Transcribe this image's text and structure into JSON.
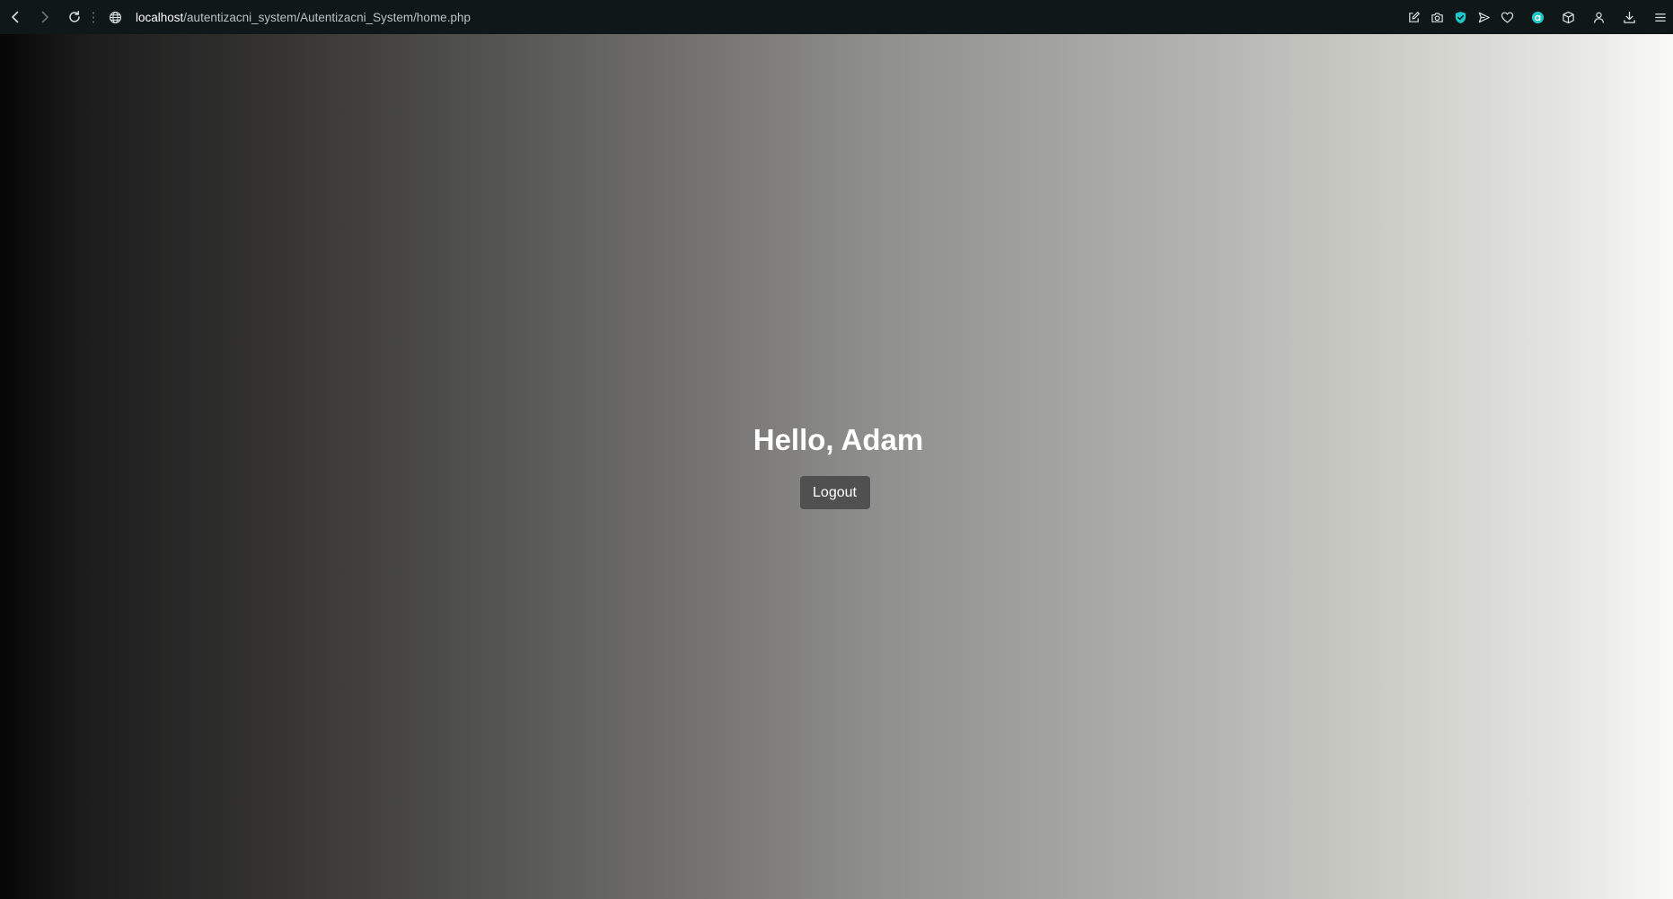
{
  "browser": {
    "url_host": "localhost",
    "url_path": "/autentizacni_system/Autentizacni_System/home.php",
    "accent_color": "#1fc8c8",
    "nav_icons": [
      "back-arrow-icon",
      "forward-arrow-icon",
      "reload-icon"
    ],
    "site_icon": "globe-icon",
    "toolbar_icons": [
      "edit-icon",
      "camera-icon",
      "shield-icon",
      "send-icon",
      "heart-icon",
      "aria-icon",
      "cube-icon",
      "profile-icon",
      "download-icon",
      "menu-icon"
    ]
  },
  "page": {
    "greeting": "Hello, Adam",
    "logout_label": "Logout"
  }
}
